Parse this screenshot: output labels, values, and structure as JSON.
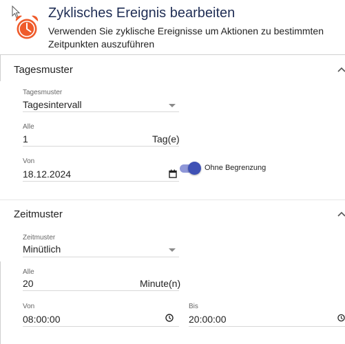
{
  "header": {
    "title": "Zyklisches Ereignis bearbeiten",
    "subtitle": "Verwenden Sie zyklische Ereignisse um Aktionen zu bestimmten Zeitpunkten auszuführen",
    "icon": "alarm-clock-icon",
    "icon_color": "#ef5b2b"
  },
  "colors": {
    "accent": "#3f51b5",
    "title": "#1f2d54"
  },
  "day_pattern": {
    "section_title": "Tagesmuster",
    "pattern_select": {
      "label": "Tagesmuster",
      "value": "Tagesintervall"
    },
    "every": {
      "label": "Alle",
      "value": "1",
      "unit": "Tag(e)"
    },
    "from_date": {
      "label": "Von",
      "value": "18.12.2024"
    },
    "no_limit_toggle": {
      "label": "Ohne Begrenzung",
      "checked": true
    }
  },
  "time_pattern": {
    "section_title": "Zeitmuster",
    "pattern_select": {
      "label": "Zeitmuster",
      "value": "Minütlich"
    },
    "every": {
      "label": "Alle",
      "value": "20",
      "unit": "Minute(n)"
    },
    "from_time": {
      "label": "Von",
      "value": "08:00:00"
    },
    "to_time": {
      "label": "Bis",
      "value": "20:00:00"
    }
  }
}
